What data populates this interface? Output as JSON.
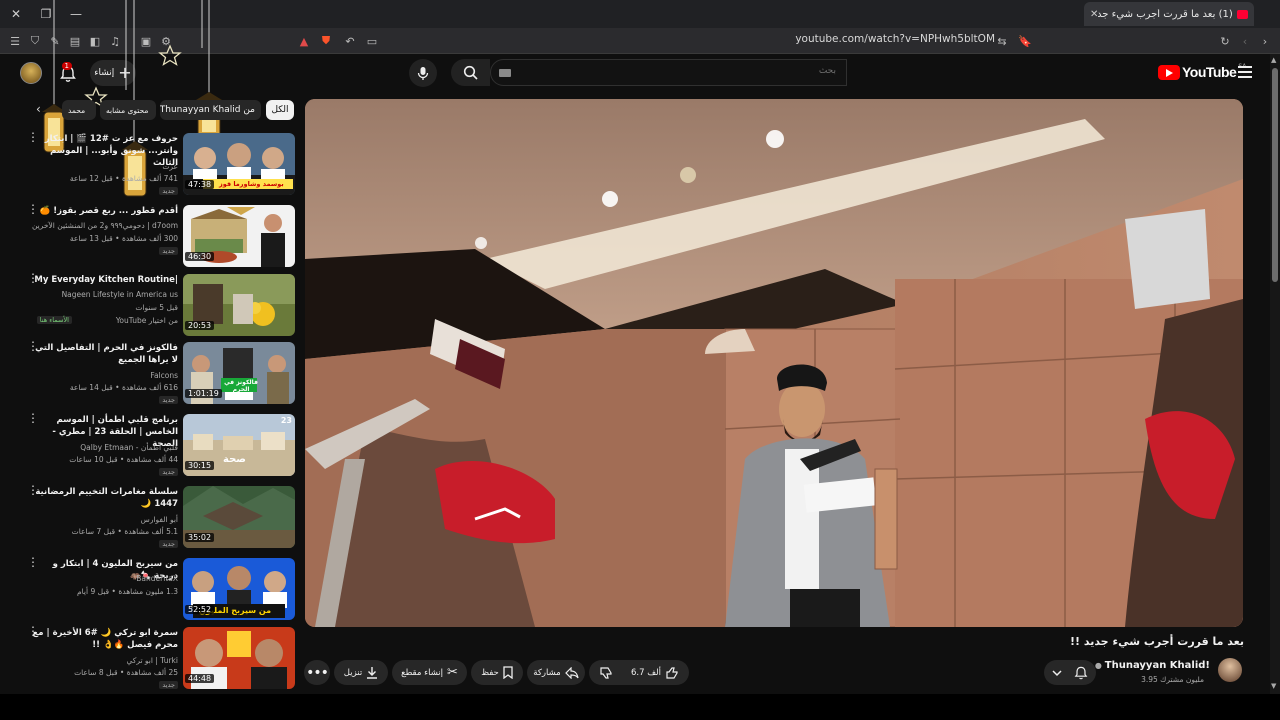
{
  "browser": {
    "tab_title": "(1) بعد ما قررت أجرب شيء جديد",
    "url": "youtube.com/watch?v=NPHwh5bltOM"
  },
  "masthead": {
    "logo_text": "YouTube",
    "country": "SA",
    "search_placeholder": "بحث",
    "create_label": "إنشاء",
    "notification_count": "1"
  },
  "chips": {
    "all": "الكل",
    "from_channel": "من Thunayyan Khalid!",
    "related": "محتوى مشابه",
    "recent": "محمد"
  },
  "video": {
    "title": "بعد ما قررت أجرب شيء جديد !!",
    "channel": "Thunayyan Khalid!",
    "subscribers": "3.95 مليون مشترك",
    "likes": "6.7 ألف",
    "share": "مشاركة",
    "save": "حفظ",
    "clip": "إنشاء مقطع",
    "download": "تنزيل"
  },
  "recommendations": [
    {
      "title": "حروف مع عز ت #12 🎬 | ابتكار وانتر... شونق وأبو... | الموسم الثالث",
      "channel": "عزت",
      "meta": "741 ألف مشاهدة • قبل 12 ساعة",
      "badge": "جديد",
      "duration": "47:38",
      "thumb": "thumb-1"
    },
    {
      "title": "أقدم قطور ... ربع قصر بقوز! 🍊",
      "channel": "d7oom | دحومي٩٩٩ و2 من المنشئين الآخرين",
      "meta": "300 ألف مشاهدة • قبل 13 ساعة",
      "badge": "جديد",
      "duration": "46:30",
      "thumb": "thumb-2"
    },
    {
      "title": "My Everyday Kitchen Routine|",
      "channel": "Nageen Lifestyle in America us",
      "meta": "قبل 5 سنوات",
      "badge": "من اختيار YouTube",
      "extra": "الأسماء هنا",
      "duration": "20:53",
      "thumb": "thumb-3"
    },
    {
      "title": "فالكونز في الحرم | التفاصيل التي لا يراها الجميع",
      "channel": "Falcons",
      "meta": "616 ألف مشاهدة • قبل 14 ساعة",
      "badge": "جديد",
      "duration": "1:01:19",
      "thumb": "thumb-4"
    },
    {
      "title": "برنامج قلبي اطمأن | الموسم الخامس | الحلقة 23 | مطري - الصحة",
      "channel": "قلبي اطمأن - Qalby Etmaan",
      "meta": "44 ألف مشاهدة • قبل 10 ساعات",
      "badge": "جديد",
      "duration": "30:15",
      "thumb": "thumb-5"
    },
    {
      "title": "سلسلة مغامرات التخييم الرمضانية 1447 🌙",
      "channel": "أبو الفوارس",
      "meta": "5.1 ألف مشاهدة • قبل 7 ساعات",
      "badge": "جديد",
      "duration": "35:02",
      "thumb": "thumb-6"
    },
    {
      "title": "من سيربح المليون 4 | ابتكار و دريحة 🍬🦛",
      "channel": "BanderitaX",
      "meta": "1.3 مليون مشاهدة • قبل 9 أيام",
      "badge": "",
      "duration": "52:52",
      "thumb": "thumb-7"
    },
    {
      "title": "سمرة ابو تركي 🌙 #6 الأخيرة | مع محرم فيصل 🔥👌 !!",
      "channel": "Turki | ابو تركي",
      "meta": "25 ألف مشاهدة • قبل 8 ساعات",
      "badge": "جديد",
      "duration": "44:48",
      "thumb": "thumb-8"
    }
  ],
  "thumb_overlays": {
    "t1": "بوسمد وشاورما قوز",
    "t4": "فالكونز في الحرم",
    "t5_num": "23",
    "t5_word": "صحة",
    "t7": "من سيربح المليون"
  },
  "colors": {
    "accent": "#ff0000",
    "bg": "#0f0f0f",
    "chip": "#272727"
  }
}
